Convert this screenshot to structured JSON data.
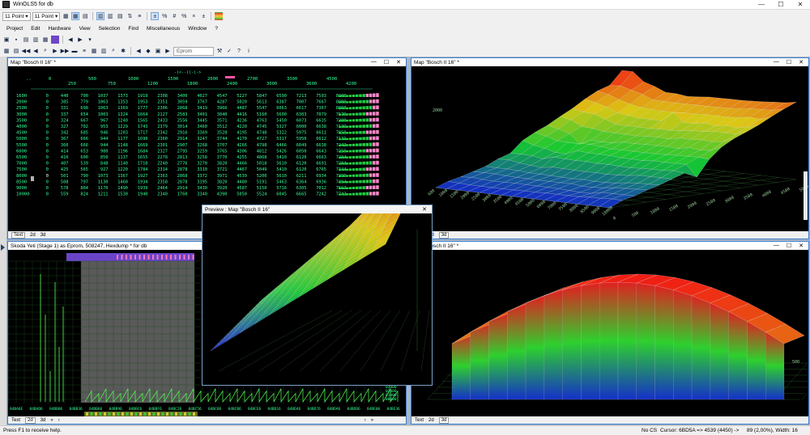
{
  "app": {
    "title": "WinOLS5 for db"
  },
  "toolbar1": {
    "zoom1": "11 Point",
    "zoom2": "11 Point"
  },
  "menu": [
    "Project",
    "Edit",
    "Hardware",
    "View",
    "Selection",
    "Find",
    "Miscellaneous",
    "Window",
    "?"
  ],
  "toolbar3": {
    "eprom_label": "Eprom"
  },
  "windows": {
    "map_table": {
      "title": "Map \"Bosch II 16\" *"
    },
    "map_3d_top": {
      "title": "Map \"Bosch II 16\" *"
    },
    "map_3d_bottom": {
      "title": "Bosch II 16\" *"
    },
    "hexdump": {
      "title": "Skoda Yeti (Stage 1) as Eprom, 508247, Hexdump * for db"
    },
    "preview": {
      "title": "Preview : Map \"Bosch II 16\""
    }
  },
  "tabs": {
    "text": "Text",
    "d2": "2d",
    "d3": "3d"
  },
  "map_table": {
    "axis_header": "-(<--)(-)->",
    "cols_even": [
      "0",
      "500",
      "1000",
      "1500",
      "2000",
      "2700",
      "3300",
      "4500"
    ],
    "cols_odd": [
      "250",
      "750",
      "1200",
      "1800",
      "2400",
      "3000",
      "3600",
      "4200"
    ],
    "rows": [
      {
        "rpm": "1600",
        "v": [
          "0",
          "440",
          "700",
          "1037",
          "1373",
          "1919",
          "2308",
          "3400",
          "4027",
          "4547",
          "5227",
          "5847",
          "6590",
          "7213",
          "7593",
          "8900"
        ]
      },
      {
        "rpm": "2000",
        "v": [
          "0",
          "385",
          "779",
          "1063",
          "1353",
          "1953",
          "2351",
          "3059",
          "3767",
          "4287",
          "5020",
          "5613",
          "6387",
          "7007",
          "7667",
          "8900"
        ]
      },
      {
        "rpm": "2500",
        "v": [
          "0",
          "331",
          "698",
          "1063",
          "1369",
          "1777",
          "2306",
          "2868",
          "3419",
          "3966",
          "4487",
          "5547",
          "6063",
          "6617",
          "7367",
          "8008"
        ]
      },
      {
        "rpm": "3000",
        "v": [
          "0",
          "337",
          "654",
          "1003",
          "1324",
          "1664",
          "2127",
          "2583",
          "3401",
          "3040",
          "4416",
          "5160",
          "5600",
          "6303",
          "7079",
          "7676"
        ]
      },
      {
        "rpm": "3500",
        "v": [
          "0",
          "324",
          "667",
          "967",
          "1240",
          "1565",
          "2433",
          "2556",
          "3445",
          "3571",
          "4236",
          "4763",
          "5450",
          "6073",
          "6635",
          "7208"
        ]
      },
      {
        "rpm": "4000",
        "v": [
          "0",
          "327",
          "702",
          "953",
          "1229",
          "1743",
          "2379",
          "3014",
          "3460",
          "3512",
          "4220",
          "4745",
          "5327",
          "6000",
          "6638",
          "7199"
        ]
      },
      {
        "rpm": "4500",
        "v": [
          "0",
          "342",
          "685",
          "946",
          "1203",
          "1717",
          "2342",
          "2916",
          "3369",
          "3528",
          "4195",
          "4748",
          "5322",
          "5975",
          "6611",
          "7050"
        ]
      },
      {
        "rpm": "5000",
        "v": [
          "0",
          "367",
          "666",
          "944",
          "1177",
          "1690",
          "2360",
          "2914",
          "3247",
          "3744",
          "4170",
          "4727",
          "5317",
          "5950",
          "6612",
          "7131"
        ]
      },
      {
        "rpm": "5500",
        "v": [
          "0",
          "360",
          "666",
          "944",
          "1148",
          "1669",
          "2301",
          "2907",
          "3268",
          "3707",
          "4266",
          "4798",
          "6466",
          "6049",
          "6638",
          "7242"
        ]
      },
      {
        "rpm": "6000",
        "v": [
          "0",
          "414",
          "653",
          "980",
          "1196",
          "1684",
          "2327",
          "2795",
          "3259",
          "3765",
          "4306",
          "4812",
          "5426",
          "6050",
          "6643",
          "7259"
        ]
      },
      {
        "rpm": "6500",
        "v": [
          "0",
          "410",
          "600",
          "850",
          "1137",
          "1655",
          "2278",
          "2813",
          "3258",
          "3770",
          "4255",
          "4868",
          "5410",
          "6120",
          "6663",
          "7284"
        ]
      },
      {
        "rpm": "7000",
        "v": [
          "0",
          "407",
          "539",
          "848",
          "1140",
          "1710",
          "2240",
          "2776",
          "3270",
          "3820",
          "4466",
          "5018",
          "5610",
          "6120",
          "6691",
          "7284"
        ]
      },
      {
        "rpm": "7500",
        "v": [
          "0",
          "425",
          "565",
          "927",
          "1220",
          "1784",
          "2314",
          "2878",
          "3310",
          "3721",
          "4467",
          "5049",
          "5410",
          "6120",
          "6765",
          "7344"
        ]
      },
      {
        "rpm": "8000",
        "v": [
          "0",
          "501",
          "790",
          "1073",
          "1367",
          "1927",
          "2363",
          "2868",
          "3372",
          "3971",
          "4539",
          "5200",
          "5610",
          "6211",
          "6934",
          "7396"
        ]
      },
      {
        "rpm": "8500",
        "v": [
          "0",
          "508",
          "797",
          "1130",
          "1460",
          "1934",
          "2358",
          "2878",
          "3395",
          "3820",
          "4480",
          "5191",
          "5463",
          "6364",
          "6936",
          "7494"
        ]
      },
      {
        "rpm": "9000",
        "v": [
          "0",
          "578",
          "804",
          "1170",
          "1490",
          "1939",
          "2464",
          "2914",
          "3430",
          "3920",
          "4587",
          "5150",
          "5716",
          "6305",
          "7012",
          "7562"
        ]
      },
      {
        "rpm": "10000",
        "v": [
          "0",
          "559",
          "824",
          "1211",
          "1530",
          "1940",
          "2340",
          "1760",
          "3340",
          "4390",
          "5050",
          "5524",
          "6045",
          "6665",
          "7242",
          "7742"
        ]
      }
    ]
  },
  "axis_3d": {
    "top_x": [
      "600",
      "1000",
      "1500",
      "2000",
      "2500",
      "3000",
      "3500",
      "4000",
      "4500",
      "5000",
      "6000",
      "7000",
      "7500",
      "8000",
      "8500",
      "9000",
      "10000"
    ],
    "top_z": [
      "0",
      "500",
      "1000",
      "1500",
      "2000",
      "2500",
      "3000",
      "3500",
      "4000",
      "4500",
      "5000"
    ],
    "top_y": [
      "2000"
    ],
    "bottom_right": [
      "500"
    ]
  },
  "hexdump": {
    "addresses": [
      "04BA6E",
      "04BAD6",
      "04BB06",
      "04BB36",
      "04BB66",
      "04BB96",
      "04BBC6",
      "04BBF6",
      "04BC26",
      "04BC56",
      "04BC86",
      "04BCB6",
      "04BCE6",
      "04BD16",
      "04BD46",
      "04BD76",
      "04BDA6",
      "04BDD6",
      "04BE06",
      "04BE36"
    ],
    "y_labels": [
      "00000",
      "01000",
      "02000",
      "03000",
      "04000",
      "05000"
    ]
  },
  "statusbar": {
    "help": "Press F1 to receive help.",
    "cs": "No CS",
    "cursor": "Cursor: 6BD5A => 4539 (4450) ->",
    "sel": "89 (2,00%), Width: 16"
  }
}
